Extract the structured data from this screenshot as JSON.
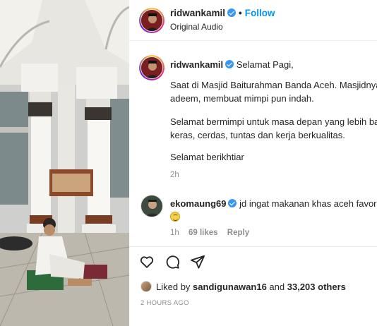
{
  "post": {
    "author": "ridwankamil",
    "follow_label": "Follow",
    "dot": "•",
    "audio": "Original Audio"
  },
  "caption": {
    "author": "ridwankamil",
    "line1": "Selamat Pagi,",
    "line2": "Saat di Masjid Baiturahman Banda Aceh. Masjidnya i",
    "line3": "adeem, membuat mimpi pun indah.",
    "line4": "Selamat bermimpi untuk masa depan yang lebih bai",
    "line5": "keras, cerdas, tuntas dan kerja berkualitas.",
    "line6": "Selamat berikhtiar",
    "time": "2h"
  },
  "comment": {
    "author": "ekomaung69",
    "text": "jd ingat makanan khas aceh favorit",
    "time": "1h",
    "likes": "69 likes",
    "reply": "Reply"
  },
  "likes": {
    "prefix": "Liked by",
    "user": "sandigunawan16",
    "and": "and",
    "count": "33,203 others"
  },
  "timestamp": "2 HOURS AGO",
  "icons": {
    "like": "heart-icon",
    "comment": "comment-icon",
    "share": "share-icon",
    "verified": "verified-badge-icon"
  },
  "colors": {
    "link": "#0095f6",
    "verified": "#3897f0",
    "muted": "#8e8e8e",
    "text": "#262626"
  }
}
